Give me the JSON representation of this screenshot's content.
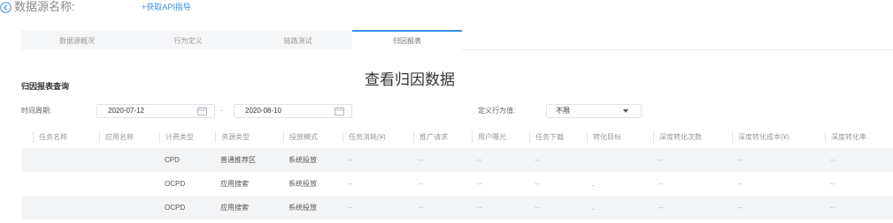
{
  "header": {
    "back_icon": "arrow-left-circle-icon",
    "title": "数据源名称:",
    "api_link": "+获取API指导"
  },
  "tabs": [
    {
      "label": "数据源概况",
      "active": false
    },
    {
      "label": "行为定义",
      "active": false
    },
    {
      "label": "链路测试",
      "active": false
    },
    {
      "label": "归因报表",
      "active": true
    }
  ],
  "section": {
    "title": "归因报表查询",
    "heading": "查看归因数据"
  },
  "filters": {
    "period_label": "时间周期:",
    "start_date": "2020-07-12",
    "range_separator": "-",
    "end_date": "2020-08-10",
    "calendar_icon": "calendar-icon",
    "behavior_label": "定义行为值:",
    "behavior_value": "不限",
    "behavior_chevron_icon": "chevron-down-icon"
  },
  "table": {
    "columns": [
      "任务名称",
      "应用名称",
      "计费类型",
      "资源类型",
      "投放模式",
      "任务消耗(¥)",
      "推广请求",
      "用户曝光",
      "任务下载",
      "转化目标",
      "深度转化次数",
      "深度转化成本(¥)",
      "深度转化率"
    ],
    "rows": [
      [
        "",
        "",
        "CPD",
        "普通推荐区",
        "系统投放",
        "--",
        "--",
        "--",
        "--",
        "",
        "--",
        "--",
        "--"
      ],
      [
        "",
        "",
        "OCPD",
        "应用搜索",
        "系统投放",
        "--",
        "--",
        "--",
        "--",
        ".",
        "--",
        "--",
        "--"
      ],
      [
        "",
        "",
        "OCPD",
        "应用搜索",
        "系统投放",
        "--",
        "--",
        "--",
        "--",
        ".",
        "--",
        "--",
        "--"
      ]
    ]
  },
  "colors": {
    "accent": "#3a8ee6",
    "text": "#333333",
    "muted": "#999999",
    "row_stripe": "#f3f4f6"
  }
}
